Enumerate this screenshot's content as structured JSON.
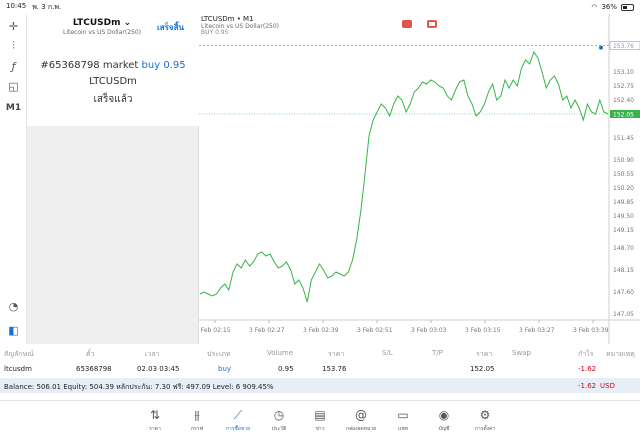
{
  "status": {
    "time": "10:45",
    "date": "พ. 3 ก.พ.",
    "battery": "36%"
  },
  "toolbar": {
    "timeframe": "M1"
  },
  "order": {
    "symbol": "LTCUSDm",
    "symbol_desc": "Litecoin vs US Dollar(250)",
    "done_label": "เสร็จสิ้น",
    "ticket_prefix": "#65368798 market",
    "ticket_type": "buy 0.95",
    "ticket_symbol": "LTCUSDm",
    "ticket_status": "เสร็จแล้ว"
  },
  "chart": {
    "title": "LTCUSDm • M1",
    "subtitle": "Litecoin vs US Dollar(250)",
    "buy_label": "BUY 0.95"
  },
  "chart_data": {
    "type": "line",
    "x_labels": [
      "3 Feb 02:15",
      "3 Feb 02:27",
      "3 Feb 02:39",
      "3 Feb 02:51",
      "3 Feb 03:03",
      "3 Feb 03:15",
      "3 Feb 03:27",
      "3 Feb 03:39"
    ],
    "y_ticks": [
      "153.76",
      "153.10",
      "152.75",
      "152.40",
      "152.05",
      "151.45",
      "150.90",
      "150.55",
      "150.20",
      "149.85",
      "149.50",
      "149.15",
      "148.70",
      "148.15",
      "147.60",
      "147.05"
    ],
    "ylim": [
      146.9,
      154.0
    ],
    "position_price": 153.76,
    "current_price": 152.05,
    "current_label": "152.05",
    "position_label": "153.76",
    "values": [
      147.55,
      147.6,
      147.55,
      147.5,
      147.55,
      147.7,
      147.8,
      147.65,
      148.1,
      148.3,
      148.2,
      148.4,
      148.25,
      148.35,
      148.55,
      148.6,
      148.5,
      148.55,
      148.35,
      148.2,
      148.25,
      148.35,
      148.15,
      147.8,
      147.9,
      147.7,
      147.35,
      147.9,
      148.1,
      148.3,
      148.15,
      147.95,
      148.0,
      148.1,
      148.05,
      148.0,
      148.1,
      148.4,
      148.9,
      149.6,
      150.5,
      151.5,
      151.9,
      152.1,
      152.3,
      152.2,
      152.0,
      152.3,
      152.5,
      152.4,
      152.1,
      152.3,
      152.6,
      152.7,
      152.85,
      152.8,
      152.9,
      152.85,
      152.75,
      152.7,
      152.5,
      152.4,
      152.65,
      152.85,
      152.9,
      152.5,
      152.3,
      152.0,
      152.1,
      152.3,
      152.6,
      152.8,
      152.4,
      152.5,
      152.9,
      152.7,
      152.9,
      152.75,
      153.2,
      153.4,
      153.3,
      153.6,
      153.45,
      153.1,
      152.7,
      152.9,
      153.0,
      152.8,
      152.4,
      152.5,
      152.2,
      152.4,
      152.2,
      151.9,
      152.3,
      152.1,
      152.05,
      152.4,
      152.1,
      152.05
    ]
  },
  "table": {
    "headers": [
      "สัญลักษณ์",
      "ตั๋ว",
      "เวลา",
      "ประเภท",
      "Volume",
      "ราคา",
      "S/L",
      "T/P",
      "ราคา",
      "Swap",
      "กำไร",
      "หมายเหตุ"
    ],
    "row": {
      "symbol": "ltcusdm",
      "ticket": "65368798",
      "time": "02.03 03:45",
      "type": "buy",
      "volume": "0.95",
      "open_price": "153.76",
      "price": "152.05",
      "profit": "-1.62"
    }
  },
  "balance": {
    "text": "Balance: 506.01 Equity: 504.39 หลักประกัน: 7.30 ฟรี: 497.09 Level: 6 909.45%",
    "profit": "-1.62",
    "currency": "USD"
  },
  "nav": [
    {
      "label": "ราคา",
      "icon": "quotes-icon"
    },
    {
      "label": "กราฟ",
      "icon": "chart-icon"
    },
    {
      "label": "การซื้อขาย",
      "icon": "trade-icon"
    },
    {
      "label": "ประวัติ",
      "icon": "history-icon"
    },
    {
      "label": "ข่าว",
      "icon": "news-icon"
    },
    {
      "label": "กล่องจดหมาย",
      "icon": "mailbox-icon"
    },
    {
      "label": "แชท",
      "icon": "chat-icon"
    },
    {
      "label": "บัญชี",
      "icon": "account-icon"
    },
    {
      "label": "การตั้งค่า",
      "icon": "settings-icon"
    }
  ],
  "colors": {
    "accent": "#1a6fd6",
    "line": "#35b547",
    "negative": "#d0021b",
    "position_line": "#7f9fd8"
  }
}
